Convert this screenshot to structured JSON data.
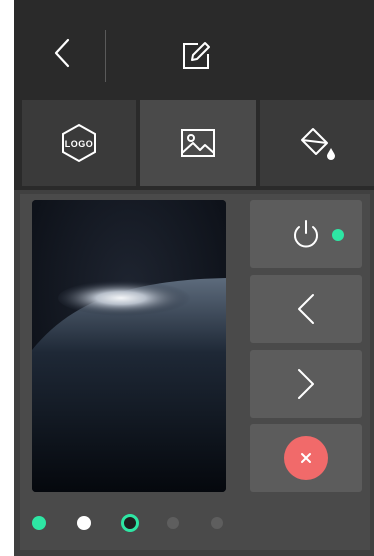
{
  "header": {
    "back_icon": "chevron-left-icon",
    "edit_icon": "edit-square-icon"
  },
  "tabs": [
    {
      "id": "logo",
      "icon": "logo-hexagon-icon",
      "label": "LOGO",
      "active": false
    },
    {
      "id": "image",
      "icon": "image-icon",
      "active": true
    },
    {
      "id": "fill",
      "icon": "paint-bucket-icon",
      "active": false
    }
  ],
  "controls": [
    {
      "id": "power",
      "icon": "power-icon",
      "status": "on",
      "status_color": "#2ee6a4"
    },
    {
      "id": "prev",
      "icon": "chevron-left-icon"
    },
    {
      "id": "next",
      "icon": "chevron-right-icon"
    },
    {
      "id": "close",
      "icon": "close-icon",
      "color": "#f16a6a"
    }
  ],
  "pagination": {
    "count": 5,
    "current_index": 2,
    "colors": {
      "accent": "#2ee6a4",
      "white": "#ffffff",
      "inactive": "#5e5e5e"
    }
  },
  "colors": {
    "panel_bg": "#2a2a2a",
    "tab_bg": "#3a3a3a",
    "tab_active_bg": "#4a4a4a",
    "control_bg": "#5c5c5c"
  }
}
